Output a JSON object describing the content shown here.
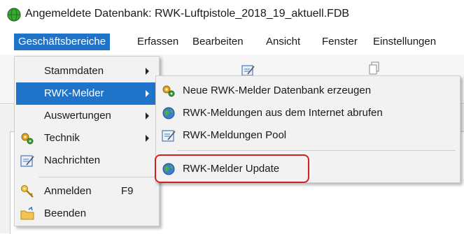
{
  "window": {
    "title": "Angemeldete Datenbank: RWK-Luftpistole_2018_19_aktuell.FDB"
  },
  "menubar": {
    "items": [
      "Geschäftsbereiche",
      "Erfassen",
      "Bearbeiten",
      "Ansicht",
      "Fenster",
      "Einstellungen"
    ]
  },
  "main_menu": {
    "items": [
      {
        "label": "Stammdaten",
        "icon": "none",
        "submenu": true
      },
      {
        "label": "RWK-Melder",
        "icon": "none",
        "submenu": true,
        "highlighted": true
      },
      {
        "label": "Auswertungen",
        "icon": "none",
        "submenu": true
      },
      {
        "label": "Technik",
        "icon": "gears-icon",
        "submenu": true
      },
      {
        "label": "Nachrichten",
        "icon": "notepad-icon",
        "submenu": false
      },
      {
        "label": "Anmelden",
        "shortcut": "F9",
        "icon": "key-icon",
        "submenu": false
      },
      {
        "label": "Beenden",
        "icon": "exit-folder-icon",
        "submenu": false
      }
    ]
  },
  "sub_menu": {
    "items": [
      {
        "label": "Neue RWK-Melder Datenbank erzeugen",
        "icon": "gears-icon"
      },
      {
        "label": "RWK-Meldungen aus dem Internet abrufen",
        "icon": "globe-icon"
      },
      {
        "label": "RWK-Meldungen Pool",
        "icon": "notepad-icon"
      },
      {
        "label": "RWK-Melder Update",
        "icon": "globe-icon",
        "marked": true
      }
    ]
  },
  "background": {
    "partial_letter": "t"
  },
  "colors": {
    "highlight": "#1f73c8",
    "callout": "#d21f1f",
    "menu_bg": "#f2f2f2"
  }
}
